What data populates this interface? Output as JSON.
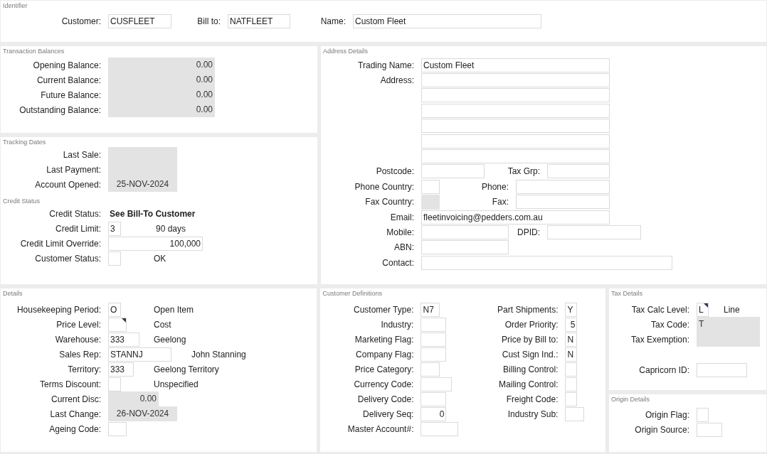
{
  "panels": [
    {
      "sections": [
        {
          "title": "Identifier",
          "rows": [
            {
              "items": [
                {
                  "kind": "label",
                  "text": "Customer:"
                },
                {
                  "kind": "input",
                  "value": "CUSFLEET"
                },
                {
                  "kind": "label",
                  "text": "Bill to:"
                },
                {
                  "kind": "input",
                  "value": "NATFLEET"
                },
                {
                  "kind": "label",
                  "text": "Name:"
                },
                {
                  "kind": "input",
                  "value": "Custom Fleet"
                }
              ]
            }
          ]
        }
      ]
    },
    {
      "sections": [
        {
          "title": "Transaction Balances",
          "rows": [
            {
              "items": [
                {
                  "kind": "label",
                  "text": "Opening Balance:"
                },
                {
                  "kind": "number-readonly",
                  "value": "0.00"
                }
              ]
            },
            {
              "items": [
                {
                  "kind": "label",
                  "text": "Current Balance:"
                },
                {
                  "kind": "number-readonly",
                  "value": "0.00"
                }
              ]
            },
            {
              "items": [
                {
                  "kind": "label",
                  "text": "Future Balance:"
                },
                {
                  "kind": "number-readonly",
                  "value": "0.00"
                }
              ]
            },
            {
              "items": [
                {
                  "kind": "label",
                  "text": "Outstanding Balance:"
                },
                {
                  "kind": "number-readonly",
                  "value": "0.00"
                }
              ]
            }
          ]
        }
      ]
    },
    {
      "sections": [
        {
          "title": "Tracking Dates",
          "rows": [
            {
              "items": [
                {
                  "kind": "label",
                  "text": "Last Sale:"
                },
                {
                  "kind": "date-readonly"
                }
              ]
            },
            {
              "items": [
                {
                  "kind": "label",
                  "text": "Last Payment:"
                },
                {
                  "kind": "date-readonly"
                }
              ]
            },
            {
              "items": [
                {
                  "kind": "label",
                  "text": "Account Opened:"
                },
                {
                  "kind": "date-readonly",
                  "value": "25-NOV-2024"
                }
              ]
            }
          ]
        },
        {
          "title": "Credit Status",
          "rows": [
            {
              "items": [
                {
                  "kind": "label",
                  "text": "Credit Status:"
                },
                {
                  "kind": "strong-text",
                  "text": "See Bill-To Customer"
                }
              ]
            },
            {
              "items": [
                {
                  "kind": "label",
                  "text": "Credit Limit:"
                },
                {
                  "kind": "input",
                  "value": "3"
                },
                {
                  "kind": "text",
                  "text": "90 days"
                }
              ]
            },
            {
              "items": [
                {
                  "kind": "label",
                  "text": "Credit Limit Override:"
                },
                {
                  "kind": "number-input",
                  "value": "100,000"
                }
              ]
            },
            {
              "items": [
                {
                  "kind": "label",
                  "text": "Customer Status:"
                },
                {
                  "kind": "input"
                },
                {
                  "kind": "text",
                  "text": "OK"
                }
              ]
            }
          ]
        }
      ]
    },
    {
      "sections": [
        {
          "title": "Address Details",
          "rows": [
            {
              "items": [
                {
                  "kind": "label",
                  "text": "Trading Name:"
                },
                {
                  "kind": "input",
                  "value": "Custom Fleet"
                }
              ]
            },
            {
              "items": [
                {
                  "kind": "label",
                  "text": "Address:"
                },
                {
                  "kind": "input"
                }
              ]
            },
            {
              "items": [
                {
                  "kind": "input"
                }
              ]
            },
            {
              "items": [
                {
                  "kind": "input"
                }
              ]
            },
            {
              "items": [
                {
                  "kind": "input"
                }
              ]
            },
            {
              "items": [
                {
                  "kind": "input"
                }
              ]
            },
            {
              "items": [
                {
                  "kind": "input"
                }
              ]
            },
            {
              "items": [
                {
                  "kind": "label",
                  "text": "Postcode:"
                },
                {
                  "kind": "input"
                },
                {
                  "kind": "label",
                  "text": "Tax Grp:"
                },
                {
                  "kind": "input"
                }
              ]
            },
            {
              "items": [
                {
                  "kind": "label",
                  "text": "Phone Country:"
                },
                {
                  "kind": "input"
                },
                {
                  "kind": "label",
                  "text": "Phone:"
                },
                {
                  "kind": "input"
                }
              ]
            },
            {
              "items": [
                {
                  "kind": "label",
                  "text": "Fax Country:"
                },
                {
                  "kind": "readonly"
                },
                {
                  "kind": "label",
                  "text": "Fax:"
                },
                {
                  "kind": "input"
                }
              ]
            },
            {
              "items": [
                {
                  "kind": "label",
                  "text": "Email:"
                },
                {
                  "kind": "input",
                  "value": "fleetinvoicing@pedders.com.au"
                }
              ]
            },
            {
              "items": [
                {
                  "kind": "label",
                  "text": "Mobile:"
                },
                {
                  "kind": "input"
                },
                {
                  "kind": "label",
                  "text": "DPID:"
                },
                {
                  "kind": "input"
                }
              ]
            },
            {
              "items": [
                {
                  "kind": "label",
                  "text": "ABN:"
                },
                {
                  "kind": "input"
                }
              ]
            },
            {
              "items": [
                {
                  "kind": "label",
                  "text": "Contact:"
                },
                {
                  "kind": "input"
                }
              ]
            }
          ]
        }
      ]
    },
    {
      "sections": [
        {
          "title": "Details",
          "rows": [
            {
              "items": [
                {
                  "kind": "label",
                  "text": "Housekeeping Period:"
                },
                {
                  "kind": "input",
                  "value": "O"
                },
                {
                  "kind": "text",
                  "text": "Open Item"
                }
              ]
            },
            {
              "items": [
                {
                  "kind": "label",
                  "text": "Price Level:"
                },
                {
                  "kind": "select"
                },
                {
                  "kind": "text",
                  "text": "Cost"
                }
              ]
            },
            {
              "items": [
                {
                  "kind": "label",
                  "text": "Warehouse:"
                },
                {
                  "kind": "input",
                  "value": "333"
                },
                {
                  "kind": "text",
                  "text": "Geelong"
                }
              ]
            },
            {
              "items": [
                {
                  "kind": "label",
                  "text": "Sales Rep:"
                },
                {
                  "kind": "input",
                  "value": "STANNJ"
                },
                {
                  "kind": "text",
                  "text": "John Stanning"
                }
              ]
            },
            {
              "items": [
                {
                  "kind": "label",
                  "text": "Territory:"
                },
                {
                  "kind": "input",
                  "value": "333"
                },
                {
                  "kind": "text",
                  "text": "Geelong Territory"
                }
              ]
            },
            {
              "items": [
                {
                  "kind": "label",
                  "text": "Terms Discount:"
                },
                {
                  "kind": "input"
                },
                {
                  "kind": "text",
                  "text": "Unspecified"
                }
              ]
            },
            {
              "items": [
                {
                  "kind": "label",
                  "text": "Current Disc:"
                },
                {
                  "kind": "number-readonly",
                  "value": "0.00"
                }
              ]
            },
            {
              "items": [
                {
                  "kind": "label",
                  "text": "Last Change:"
                },
                {
                  "kind": "date-readonly",
                  "value": "26-NOV-2024"
                }
              ]
            },
            {
              "items": [
                {
                  "kind": "label",
                  "text": "Ageing Code:"
                },
                {
                  "kind": "input"
                }
              ]
            }
          ]
        }
      ]
    },
    {
      "sections": [
        {
          "title": "Customer Definitions",
          "rows": [
            {
              "items": [
                {
                  "kind": "label",
                  "text": "Customer Type:"
                },
                {
                  "kind": "input",
                  "value": "N7"
                },
                {
                  "kind": "label",
                  "text": "Part Shipments:"
                },
                {
                  "kind": "input",
                  "value": "Y"
                }
              ]
            },
            {
              "items": [
                {
                  "kind": "label",
                  "text": "Industry:"
                },
                {
                  "kind": "input"
                },
                {
                  "kind": "label",
                  "text": "Order Priority:"
                },
                {
                  "kind": "number-input",
                  "value": "5"
                }
              ]
            },
            {
              "items": [
                {
                  "kind": "label",
                  "text": "Marketing Flag:"
                },
                {
                  "kind": "input"
                },
                {
                  "kind": "label",
                  "text": "Price by Bill to:"
                },
                {
                  "kind": "input",
                  "value": "N"
                }
              ]
            },
            {
              "items": [
                {
                  "kind": "label",
                  "text": "Company Flag:"
                },
                {
                  "kind": "input"
                },
                {
                  "kind": "label",
                  "text": "Cust Sign Ind.:"
                },
                {
                  "kind": "input",
                  "value": "N"
                }
              ]
            },
            {
              "items": [
                {
                  "kind": "label",
                  "text": "Price Category:"
                },
                {
                  "kind": "input"
                },
                {
                  "kind": "label",
                  "text": "Billing Control:"
                },
                {
                  "kind": "input"
                }
              ]
            },
            {
              "items": [
                {
                  "kind": "label",
                  "text": "Currency Code:"
                },
                {
                  "kind": "input"
                },
                {
                  "kind": "label",
                  "text": "Mailing Control:"
                },
                {
                  "kind": "input"
                }
              ]
            },
            {
              "items": [
                {
                  "kind": "label",
                  "text": "Delivery Code:"
                },
                {
                  "kind": "input"
                },
                {
                  "kind": "label",
                  "text": "Freight Code:"
                },
                {
                  "kind": "input"
                }
              ]
            },
            {
              "items": [
                {
                  "kind": "label",
                  "text": "Delivery Seq:"
                },
                {
                  "kind": "number-input",
                  "value": "0"
                },
                {
                  "kind": "label",
                  "text": "Industry Sub:"
                },
                {
                  "kind": "input"
                }
              ]
            },
            {
              "items": [
                {
                  "kind": "label",
                  "text": "Master Account#:"
                },
                {
                  "kind": "input"
                }
              ]
            }
          ]
        }
      ]
    },
    {
      "sections": [
        {
          "title": "Tax Details",
          "rows": [
            {
              "items": [
                {
                  "kind": "label",
                  "text": "Tax Calc Level:"
                },
                {
                  "kind": "select",
                  "value": "L"
                },
                {
                  "kind": "text",
                  "text": "Line"
                }
              ]
            },
            {
              "items": [
                {
                  "kind": "label",
                  "text": "Tax Code:"
                },
                {
                  "kind": "readonly",
                  "value": "T"
                }
              ]
            },
            {
              "items": [
                {
                  "kind": "label",
                  "text": "Tax Exemption:"
                },
                {
                  "kind": "readonly"
                }
              ]
            },
            {
              "items": [
                {
                  "kind": "label",
                  "text": "Capricorn ID:"
                },
                {
                  "kind": "input"
                }
              ]
            }
          ]
        }
      ]
    },
    {
      "sections": [
        {
          "title": "Origin Details",
          "rows": [
            {
              "items": [
                {
                  "kind": "label",
                  "text": "Origin Flag:"
                },
                {
                  "kind": "input"
                }
              ]
            },
            {
              "items": [
                {
                  "kind": "label",
                  "text": "Origin Source:"
                },
                {
                  "kind": "input"
                }
              ]
            }
          ]
        }
      ]
    }
  ]
}
